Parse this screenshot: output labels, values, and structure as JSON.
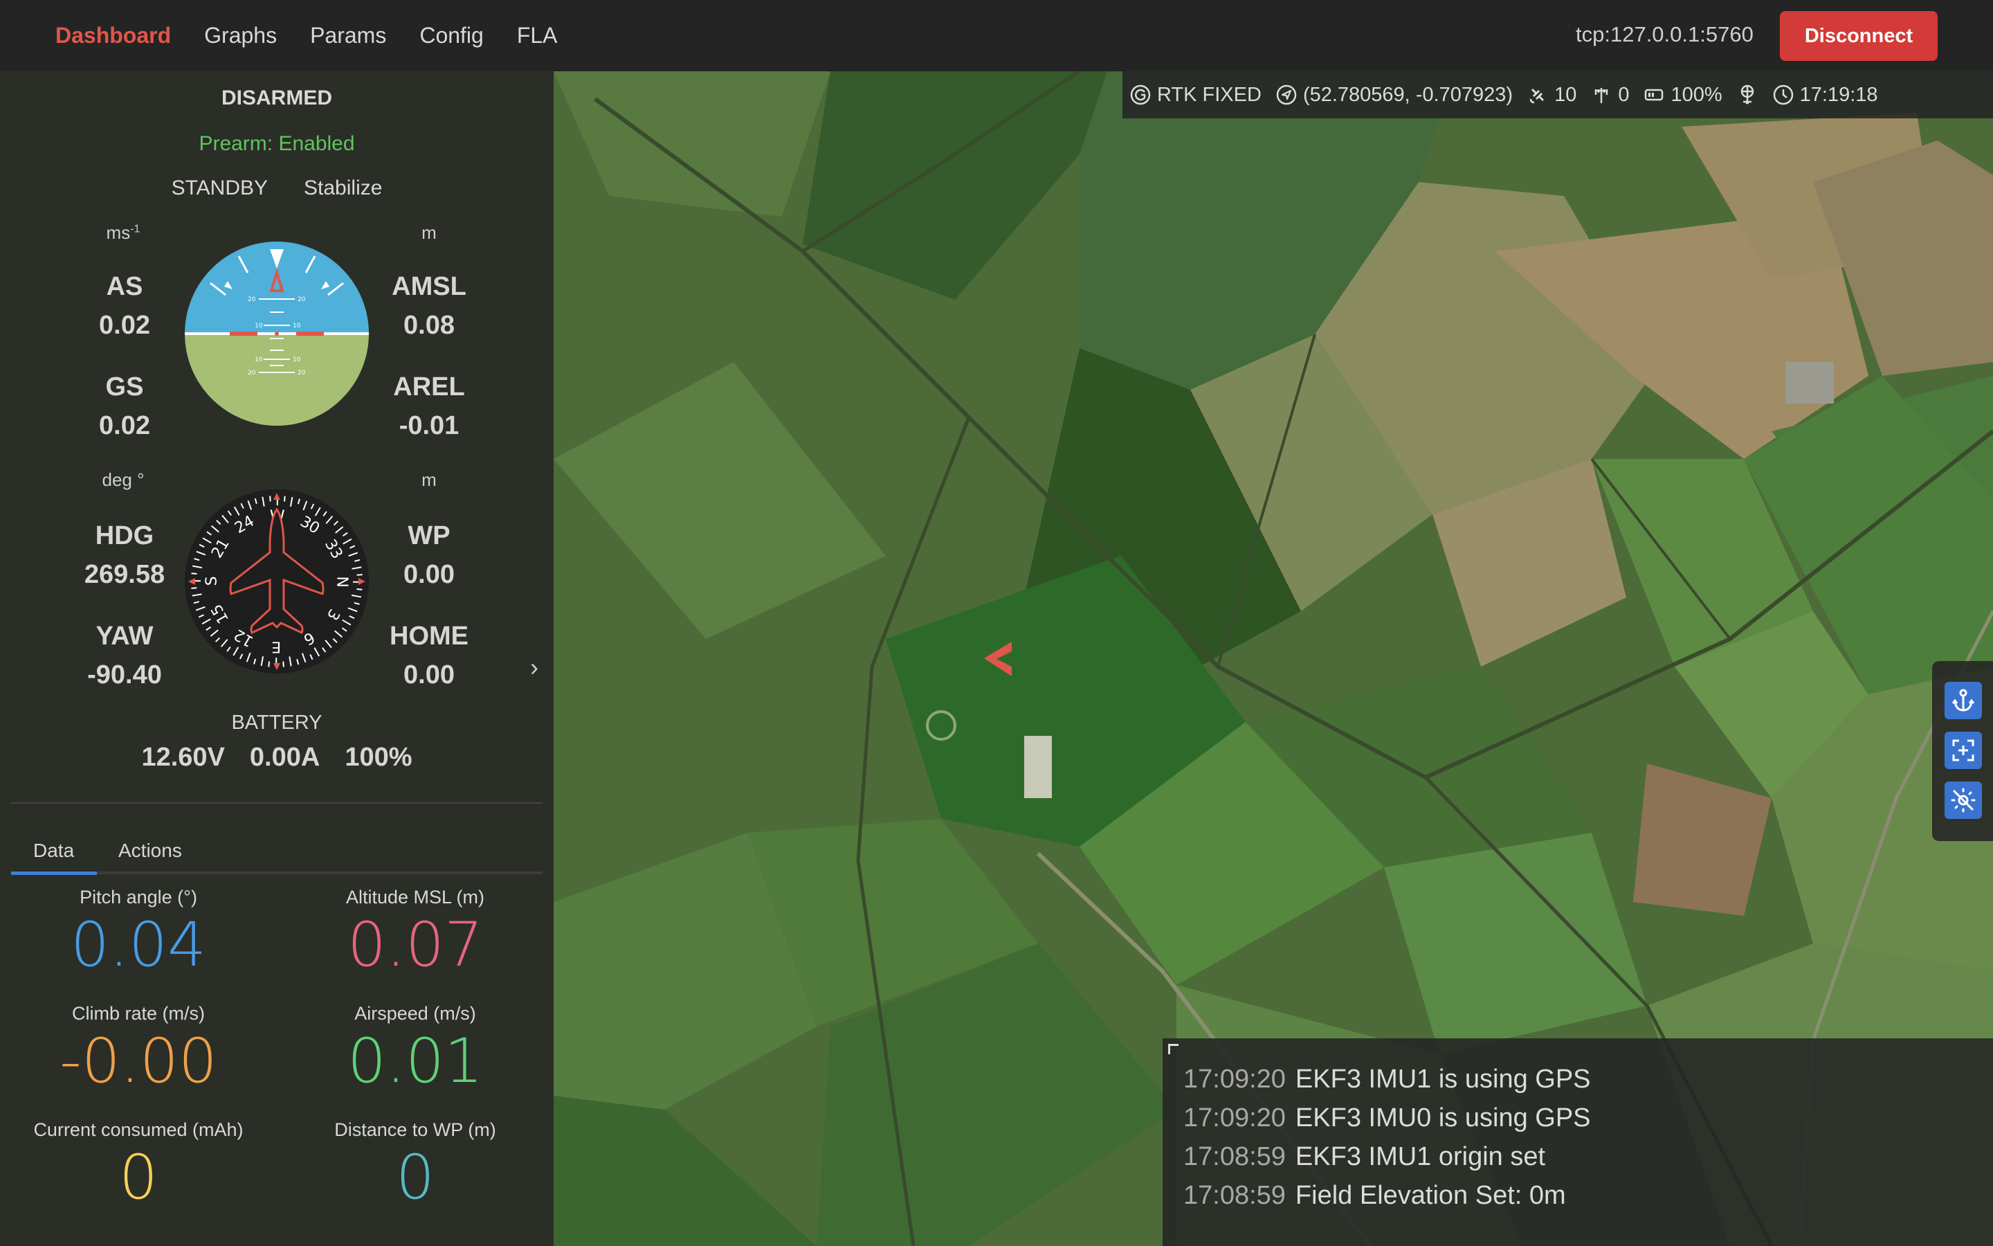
{
  "header": {
    "nav": [
      {
        "label": "Dashboard",
        "active": true
      },
      {
        "label": "Graphs",
        "active": false
      },
      {
        "label": "Params",
        "active": false
      },
      {
        "label": "Config",
        "active": false
      },
      {
        "label": "FLA",
        "active": false
      }
    ],
    "connection": "tcp:127.0.0.1:5760",
    "disconnect_label": "Disconnect",
    "disconnect_color": "#d23b37",
    "active_color": "#e0564a"
  },
  "status_bar": {
    "gps_fix": "RTK FIXED",
    "position": "(52.780569, -0.707923)",
    "satellites": "10",
    "signal": "0",
    "battery": "100%",
    "time": "17:19:18",
    "icons": [
      "gps-fix-icon",
      "location-arrow-icon",
      "satellite-icon",
      "antenna-icon",
      "battery-icon",
      "network-icon",
      "clock-icon"
    ]
  },
  "sidebar": {
    "arm_state": "DISARMED",
    "prearm": "Prearm: Enabled",
    "system_status": "STANDBY",
    "flight_mode": "Stabilize",
    "speed_unit": "ms",
    "speed_unit_sup": "-1",
    "alt_unit": "m",
    "as_label": "AS",
    "as_value": "0.02",
    "gs_label": "GS",
    "gs_value": "0.02",
    "amsl_label": "AMSL",
    "amsl_value": "0.08",
    "arel_label": "AREL",
    "arel_value": "-0.01",
    "deg_unit": "deg °",
    "dist_unit": "m",
    "hdg_label": "HDG",
    "hdg_value": "269.58",
    "yaw_label": "YAW",
    "yaw_value": "-90.40",
    "wp_label": "WP",
    "wp_value": "0.00",
    "home_label": "HOME",
    "home_value": "0.00",
    "attitude": {
      "pitch_deg": 0.04,
      "roll_deg": 0,
      "pitch_ticks": [
        "20",
        "10",
        "10",
        "20"
      ]
    },
    "compass": {
      "heading_deg": 269.58,
      "labels": [
        "N",
        "3",
        "6",
        "E",
        "12",
        "15",
        "S",
        "21",
        "24",
        "W",
        "30",
        "33"
      ]
    },
    "battery_title": "BATTERY",
    "battery_voltage": "12.60V",
    "battery_current": "0.00A",
    "battery_percent": "100%",
    "tabs": [
      {
        "label": "Data",
        "active": true
      },
      {
        "label": "Actions",
        "active": false
      }
    ],
    "metrics": [
      {
        "label": "Pitch angle (°)",
        "value": "0.04",
        "color": "#4a9be6"
      },
      {
        "label": "Altitude MSL (m)",
        "value": "0.07",
        "color": "#e8657e"
      },
      {
        "label": "Climb rate (m/s)",
        "value": "-0.00",
        "color": "#f0a04b"
      },
      {
        "label": "Airspeed (m/s)",
        "value": "0.01",
        "color": "#5fd17a"
      },
      {
        "label": "Current consumed (mAh)",
        "value": "0",
        "color": "#f4cf58"
      },
      {
        "label": "Distance to WP (m)",
        "value": "0",
        "color": "#5ab8c4"
      }
    ],
    "collapse_icon": "›"
  },
  "map": {
    "vehicle_heading_deg": 270,
    "vehicle_color": "#e0564a",
    "tools": [
      "anchor-icon",
      "center-focus-icon",
      "no-sun-icon"
    ]
  },
  "messages": [
    {
      "time": "17:09:20",
      "text": "EKF3 IMU1 is using GPS"
    },
    {
      "time": "17:09:20",
      "text": "EKF3 IMU0 is using GPS"
    },
    {
      "time": "17:08:59",
      "text": "EKF3 IMU1 origin set"
    },
    {
      "time": "17:08:59",
      "text": "Field Elevation Set: 0m"
    }
  ]
}
